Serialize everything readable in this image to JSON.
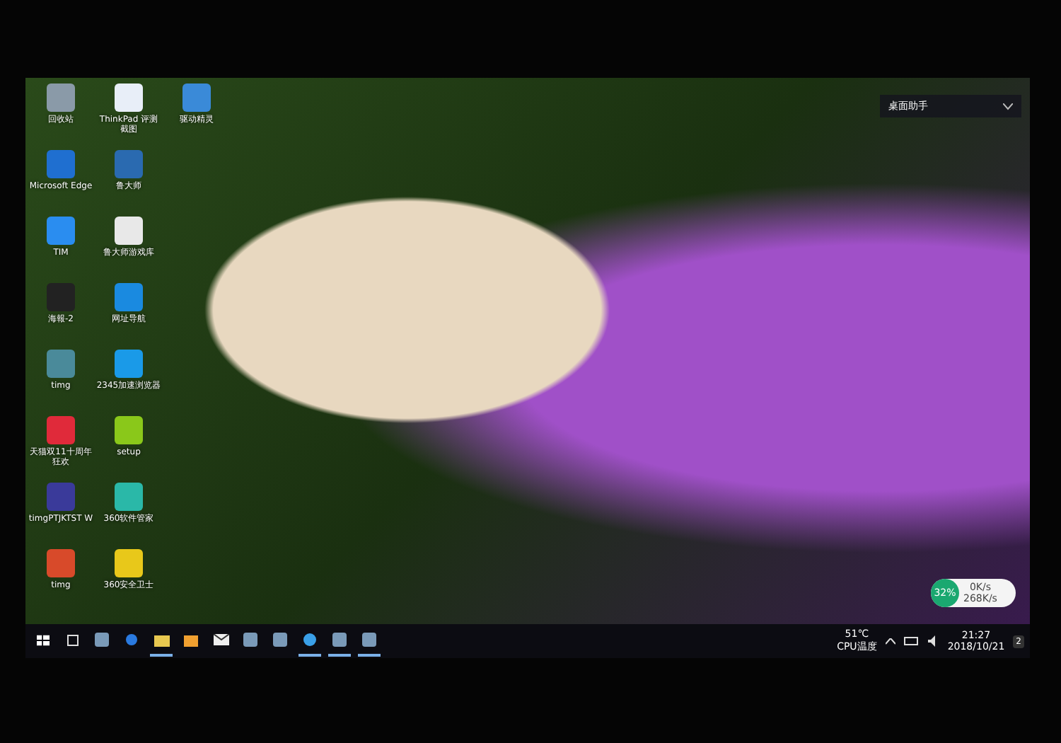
{
  "desktop": {
    "icons": [
      {
        "label": "回收站",
        "color": "#8a9aa8"
      },
      {
        "label": "Microsoft Edge",
        "color": "#1f6fd0"
      },
      {
        "label": "TIM",
        "color": "#2a8df0"
      },
      {
        "label": "海報-2",
        "color": "#222222"
      },
      {
        "label": "timg",
        "color": "#4a8a9a"
      },
      {
        "label": "天猫双11十周年狂欢",
        "color": "#e02a3a"
      },
      {
        "label": "timgPTJKTST W",
        "color": "#3a3a9a"
      },
      {
        "label": "timg",
        "color": "#d84a2a"
      },
      {
        "label": "ThinkPad 评测截图",
        "color": "#e8eef8"
      },
      {
        "label": "鲁大师",
        "color": "#2a6ab0"
      },
      {
        "label": "鲁大师游戏库",
        "color": "#e8e8e8"
      },
      {
        "label": "网址导航",
        "color": "#1a8ae0"
      },
      {
        "label": "2345加速浏览器",
        "color": "#1a9ae8"
      },
      {
        "label": "setup",
        "color": "#8ac81a"
      },
      {
        "label": "360软件管家",
        "color": "#2ab8a8"
      },
      {
        "label": "360安全卫士",
        "color": "#e8c81a"
      },
      {
        "label": "驱动精灵",
        "color": "#3a8ad8"
      }
    ]
  },
  "assistant": {
    "title": "桌面助手"
  },
  "network_widget": {
    "cpu": "32%",
    "upload": "0K/s",
    "download": "268K/s"
  },
  "taskbar": {
    "apps": [
      {
        "kind": "start",
        "running": false
      },
      {
        "kind": "taskview",
        "running": false
      },
      {
        "kind": "app",
        "running": false
      },
      {
        "kind": "edge",
        "running": false
      },
      {
        "kind": "folder",
        "running": true
      },
      {
        "kind": "store",
        "running": false
      },
      {
        "kind": "mail",
        "running": false
      },
      {
        "kind": "app",
        "running": false
      },
      {
        "kind": "app",
        "running": false
      },
      {
        "kind": "browser",
        "running": true
      },
      {
        "kind": "app",
        "running": true
      },
      {
        "kind": "app",
        "running": true
      }
    ],
    "temperature": "51℃",
    "temperature_label": "CPU温度",
    "time": "21:27",
    "date": "2018/10/21",
    "notifications": "2"
  }
}
